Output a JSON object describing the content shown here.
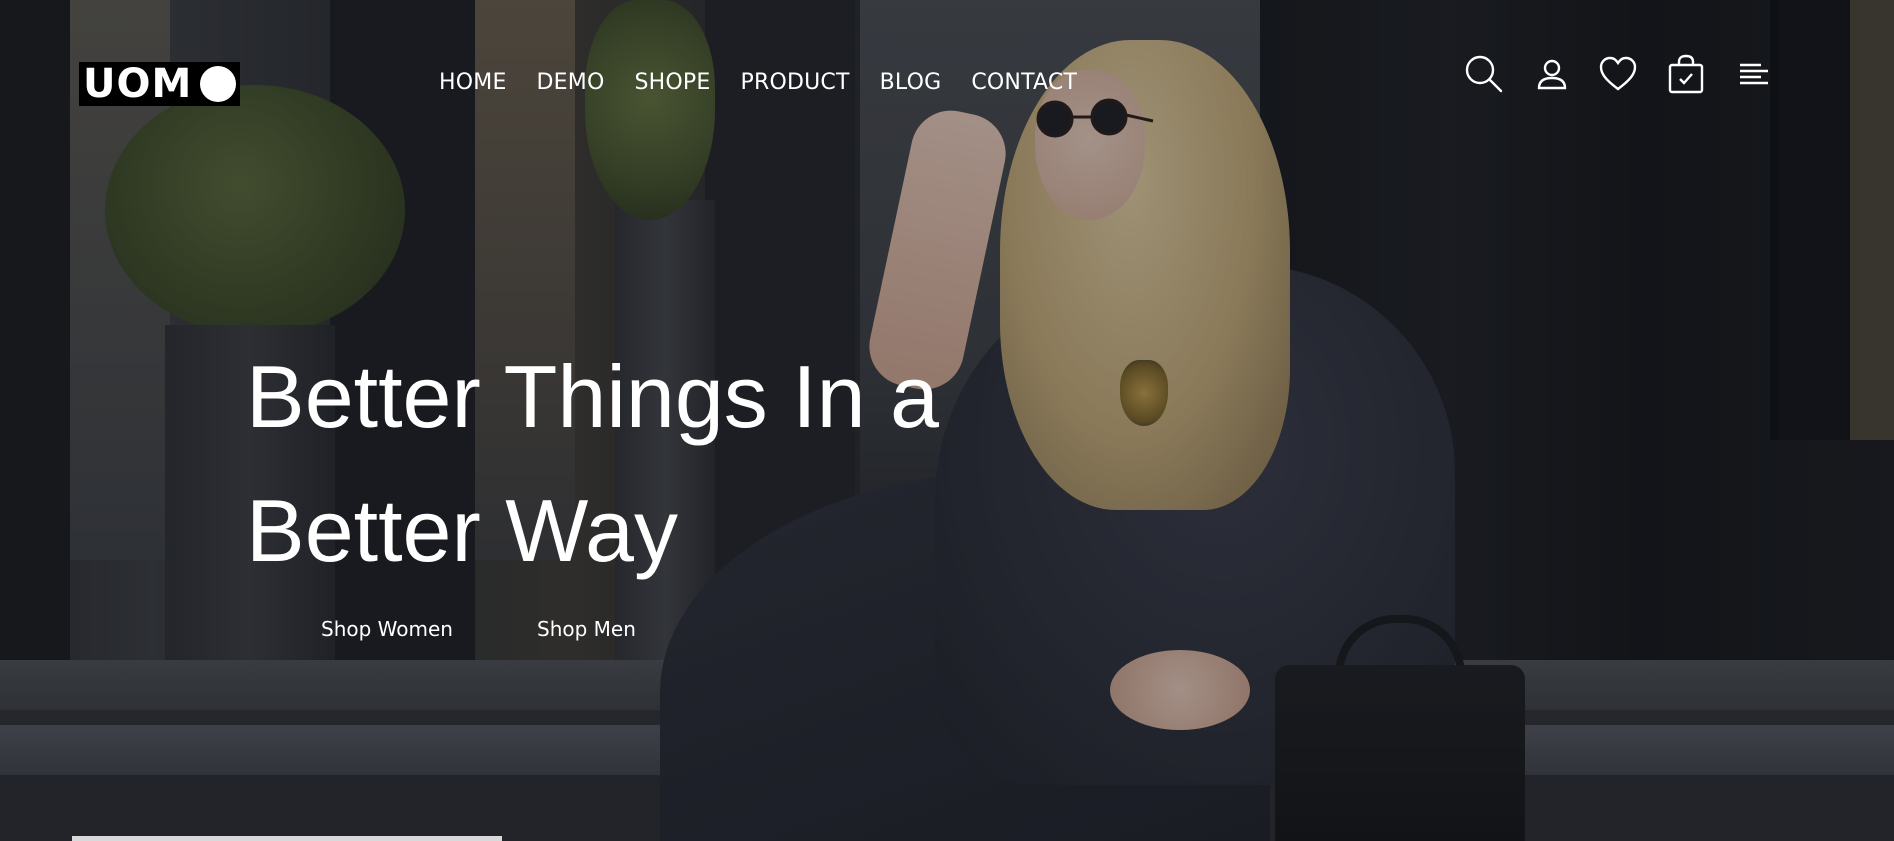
{
  "brand": {
    "logo_text": "UOM"
  },
  "nav": {
    "items": [
      {
        "label": "HOME"
      },
      {
        "label": "DEMO"
      },
      {
        "label": "SHOPE"
      },
      {
        "label": "PRODUCT"
      },
      {
        "label": "BLOG"
      },
      {
        "label": "CONTACT"
      }
    ]
  },
  "header_icons": [
    "search-icon",
    "user-icon",
    "heart-icon",
    "cart-icon",
    "menu-icon"
  ],
  "hero": {
    "headline_line1": "Better Things In a",
    "headline_line2": "Better Way",
    "cta_women": "Shop Women",
    "cta_men": "Shop Men"
  },
  "colors": {
    "text": "#ffffff",
    "background": "#1f2126",
    "logo_bg": "#000000"
  }
}
